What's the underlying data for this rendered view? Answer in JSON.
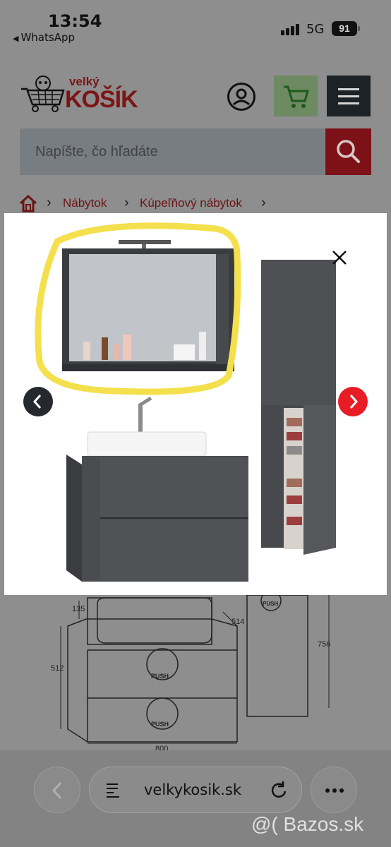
{
  "status_bar": {
    "time": "13:54",
    "back_app": "WhatsApp",
    "network": "5G",
    "battery": "91"
  },
  "header": {
    "logo_small": "velký",
    "logo_big": "KOŠÍK",
    "account_icon": "user-circle-icon",
    "cart_icon": "cart-icon",
    "menu_icon": "hamburger-icon"
  },
  "search": {
    "placeholder": "Napíšte, čo hľadáte",
    "icon": "search-icon"
  },
  "breadcrumb": {
    "home_icon": "home-icon",
    "items": [
      "Nábytok",
      "Kúpeľňový nábytok"
    ]
  },
  "lightbox": {
    "close_icon": "close-icon",
    "prev_icon": "chevron-left-icon",
    "next_icon": "chevron-right-icon",
    "annotation_color": "#f4e04d"
  },
  "drawing": {
    "dimensions": [
      "135",
      "514",
      "512",
      "756",
      "800"
    ],
    "push_label": "PUSH"
  },
  "browser": {
    "url": "velkykosik.sk",
    "watermark": "@( Bazos.sk"
  },
  "colors": {
    "brand_red": "#e81c24",
    "dark": "#25282c"
  }
}
